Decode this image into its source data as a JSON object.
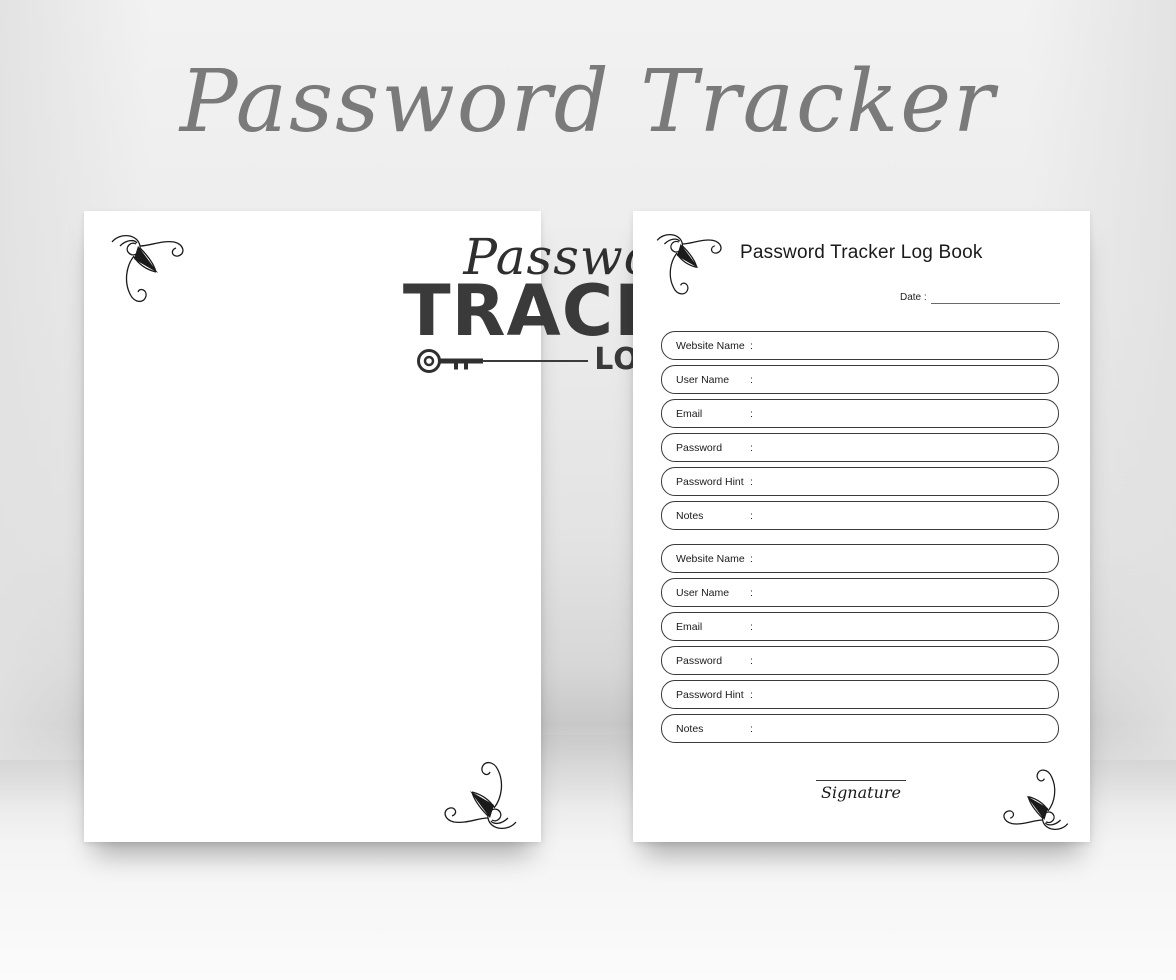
{
  "header": {
    "title": "Password Tracker"
  },
  "cover": {
    "script_line": "Password",
    "bold_line": "TRACKER",
    "sub_line": "LOG BOOK",
    "lock_icon": "padlock-icon",
    "key_icon": "key-icon",
    "corner_flourish_icon": "ornamental-flourish-icon"
  },
  "interior": {
    "heading": "Password Tracker Log Book",
    "date_label": "Date :",
    "signature_label": "Signature",
    "colon": ":",
    "groups": [
      {
        "rows": [
          {
            "label": "Website Name"
          },
          {
            "label": "User Name"
          },
          {
            "label": "Email"
          },
          {
            "label": "Password"
          },
          {
            "label": "Password Hint"
          },
          {
            "label": "Notes"
          }
        ]
      },
      {
        "rows": [
          {
            "label": "Website Name"
          },
          {
            "label": "User Name"
          },
          {
            "label": "Email"
          },
          {
            "label": "Password"
          },
          {
            "label": "Password Hint"
          },
          {
            "label": "Notes"
          }
        ]
      }
    ]
  },
  "colors": {
    "title_gray": "#7a7a7a",
    "ink": "#2f2f2f",
    "line": "#3a3a3a",
    "page": "#ffffff"
  }
}
